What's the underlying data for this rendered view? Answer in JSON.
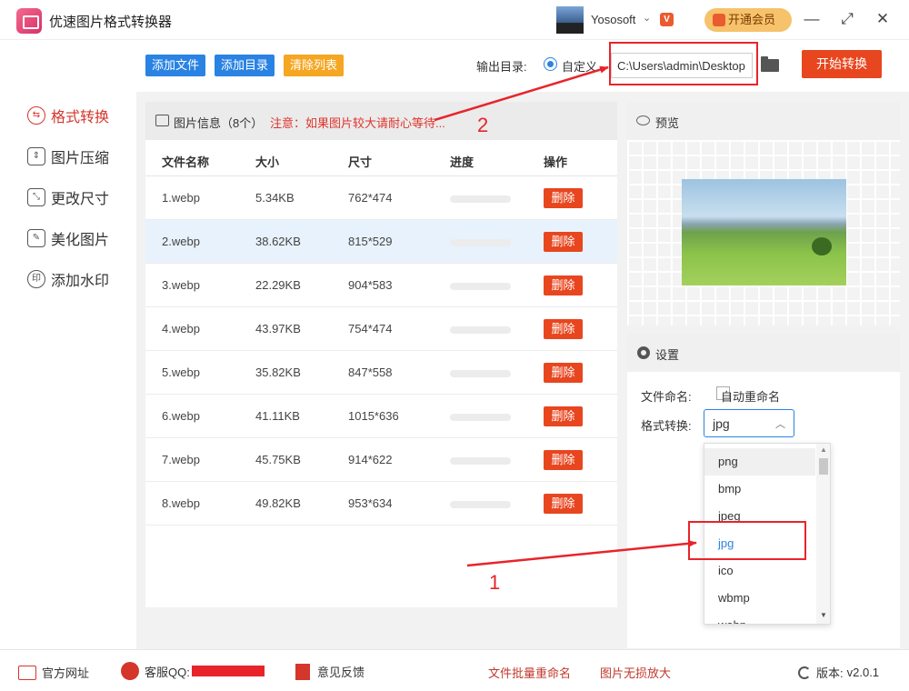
{
  "app": {
    "title": "优速图片格式转换器"
  },
  "user": {
    "name": "Yososoft",
    "vip_button": "开通会员"
  },
  "sidebar": {
    "items": [
      {
        "label": "格式转换",
        "icon": "format-convert-icon",
        "active": true
      },
      {
        "label": "图片压缩",
        "icon": "compress-icon"
      },
      {
        "label": "更改尺寸",
        "icon": "resize-icon"
      },
      {
        "label": "美化图片",
        "icon": "beautify-icon"
      },
      {
        "label": "添加水印",
        "icon": "watermark-icon"
      }
    ]
  },
  "toolbar": {
    "add_file": "添加文件",
    "add_dir": "添加目录",
    "clear_list": "清除列表",
    "output_label": "输出目录:",
    "custom_label": "自定义",
    "output_path": "C:\\Users\\admin\\Desktop",
    "start_button": "开始转换"
  },
  "file_list": {
    "info": "图片信息（8个）",
    "notice": "注意：如果图片较大请耐心等待...",
    "columns": [
      "文件名称",
      "大小",
      "尺寸",
      "进度",
      "操作"
    ],
    "delete_label": "删除",
    "rows": [
      {
        "name": "1.webp",
        "size": "5.34KB",
        "dims": "762*474"
      },
      {
        "name": "2.webp",
        "size": "38.62KB",
        "dims": "815*529"
      },
      {
        "name": "3.webp",
        "size": "22.29KB",
        "dims": "904*583"
      },
      {
        "name": "4.webp",
        "size": "43.97KB",
        "dims": "754*474"
      },
      {
        "name": "5.webp",
        "size": "35.82KB",
        "dims": "847*558"
      },
      {
        "name": "6.webp",
        "size": "41.11KB",
        "dims": "1015*636"
      },
      {
        "name": "7.webp",
        "size": "45.75KB",
        "dims": "914*622"
      },
      {
        "name": "8.webp",
        "size": "49.82KB",
        "dims": "953*634"
      }
    ]
  },
  "preview": {
    "title": "预览"
  },
  "settings": {
    "title": "设置",
    "naming_label": "文件命名:",
    "auto_rename": "自动重命名",
    "format_label": "格式转换:",
    "format_value": "jpg",
    "format_options": [
      "png",
      "bmp",
      "jpeg",
      "jpg",
      "ico",
      "wbmp",
      "webp"
    ]
  },
  "annotations": {
    "num1": "1",
    "num2": "2"
  },
  "statusbar": {
    "website": "官方网址",
    "qq": "客服QQ:",
    "feedback": "意见反馈",
    "batch_rename": "文件批量重命名",
    "lossless_enlarge": "图片无损放大",
    "version_label": "版本:",
    "version": "v2.0.1"
  },
  "colors": {
    "accent_red": "#e8461f",
    "annotation_red": "#e8242a",
    "link_blue": "#2a83e3"
  }
}
